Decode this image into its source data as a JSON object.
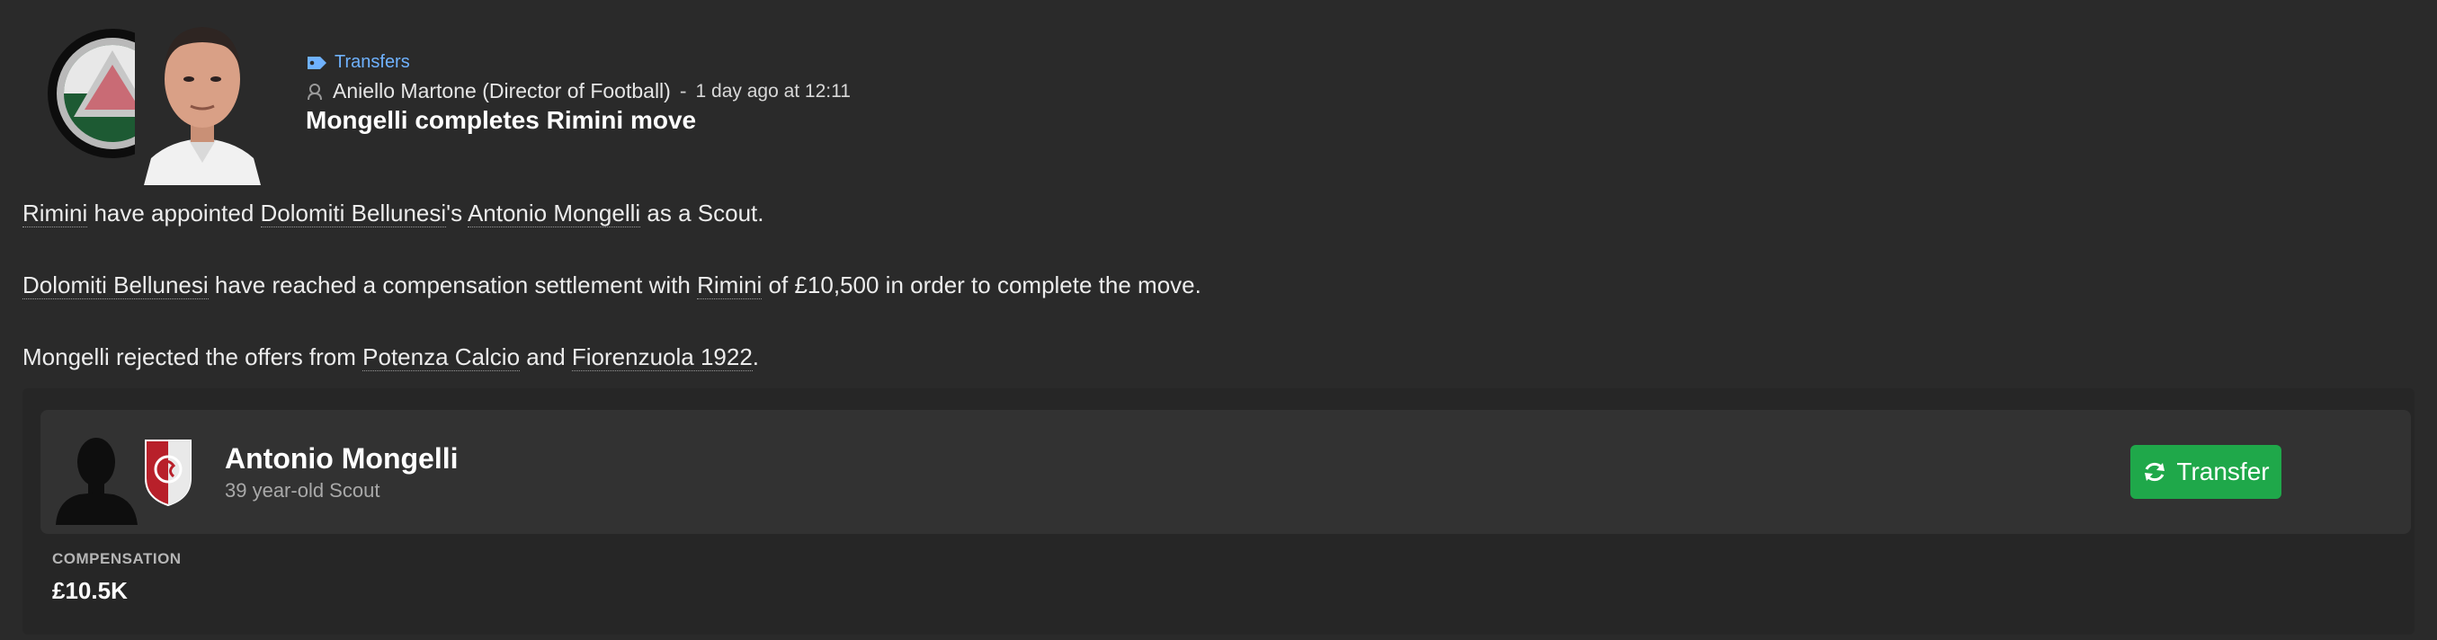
{
  "news": {
    "category": "Transfers",
    "category_icon": "tag-icon",
    "author": "Aniello Martone (Director of Football)",
    "separator": "-",
    "time": "1 day ago at 12:11",
    "title": "Mongelli completes Rimini move"
  },
  "body": {
    "p1": {
      "club": "Rimini",
      "t1": " have appointed ",
      "club2": "Dolomiti Bellunesi",
      "t2": "'s ",
      "person": "Antonio Mongelli",
      "t3": " as a Scout."
    },
    "p2": {
      "club": "Dolomiti Bellunesi",
      "t1": " have reached a compensation settlement with ",
      "club2": "Rimini",
      "t2": " of £10,500 in order to complete the move."
    },
    "p3": {
      "t1": "Mongelli rejected the offers from ",
      "club": "Potenza Calcio",
      "t2": " and ",
      "club2": "Fiorenzuola 1922",
      "t3": "."
    }
  },
  "card": {
    "name": "Antonio Mongelli",
    "subtitle": "39 year-old Scout",
    "button_label": "Transfer",
    "compensation_label": "COMPENSATION",
    "compensation_value": "£10.5K"
  },
  "colors": {
    "accent_green": "#1fa84a",
    "link_blue": "#6fb2ff",
    "background": "#2a2a2a"
  }
}
